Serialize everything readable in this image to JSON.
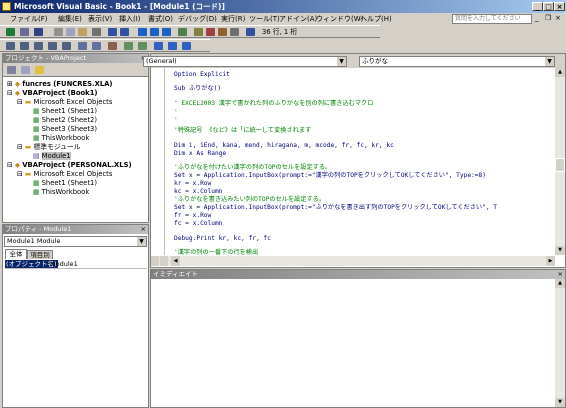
{
  "title": "Microsoft Visual Basic - Book1 - [Module1 (コード)]",
  "menu": [
    "ファイル(F)",
    "編集(E)",
    "表示(V)",
    "挿入(I)",
    "書式(O)",
    "デバッグ(D)",
    "実行(R)",
    "ツール(T)",
    "アドイン(A)",
    "ウィンドウ(W)",
    "ヘルプ(H)"
  ],
  "help_placeholder": "質問を入力してください",
  "toolbar": {
    "position": "36 行, 1 桁"
  },
  "project_panel": {
    "title": "プロジェクト - VBAProject",
    "items": [
      "funcres (FUNCRES.XLA)",
      "VBAProject (Book1)",
      "Microsoft Excel Objects",
      "Sheet1 (Sheet1)",
      "Sheet2 (Sheet2)",
      "Sheet3 (Sheet3)",
      "ThisWorkbook",
      "標準モジュール",
      "Module1",
      "VBAProject (PERSONAL.XLS)",
      "Microsoft Excel Objects",
      "Sheet1 (Sheet1)",
      "ThisWorkbook"
    ]
  },
  "properties_panel": {
    "title": "プロパティ - Module1",
    "selector": "Module1 Module",
    "tabs": [
      "全体",
      "項目別"
    ],
    "prop_name": "(オブジェクト名)",
    "prop_value": "Module1"
  },
  "code_window": {
    "object_combo": "(General)",
    "proc_combo": "ふりがな",
    "lines": [
      "Option Explicit",
      "",
      "Sub ふりがな()",
      "",
      "' EXCEL2003  漢字で書かれた列のふりがなを別の列に書き込むマクロ",
      "'",
      "'",
      "'特殊記号 《など》は「に統一して変換されます",
      "",
      "Dim i, iEnd, kana, mend, hiragana, m, mcode, fr, fc, kr, kc",
      "Dim x As Range",
      "",
      "    'ふりがなを付けたい漢字の列のTOPのセルを設定する。",
      "    Set x = Application.InputBox(prompt:=\"漢字の列のTOPをクリックしてOKしてください\", Type:=8)",
      "    kr = x.Row",
      "    kc = x.Column",
      "    'ふりがなを書き込みたい列のTOPのセルを設定する。",
      "    Set x = Application.InputBox(prompt:=\"ふりがなを書き出す列のTOPをクリックしてOKしてください\", T",
      "    fr = x.Row",
      "    fc = x.Column",
      "",
      "Debug.Print kr, kc, fr, fc",
      "",
      "    '漢字の列の一番下の行を検出"
    ]
  },
  "immediate": {
    "title": "イミディエイト"
  },
  "colors": {
    "keyword": "#000080",
    "comment": "#008000",
    "titlebar": "#0a246a"
  }
}
